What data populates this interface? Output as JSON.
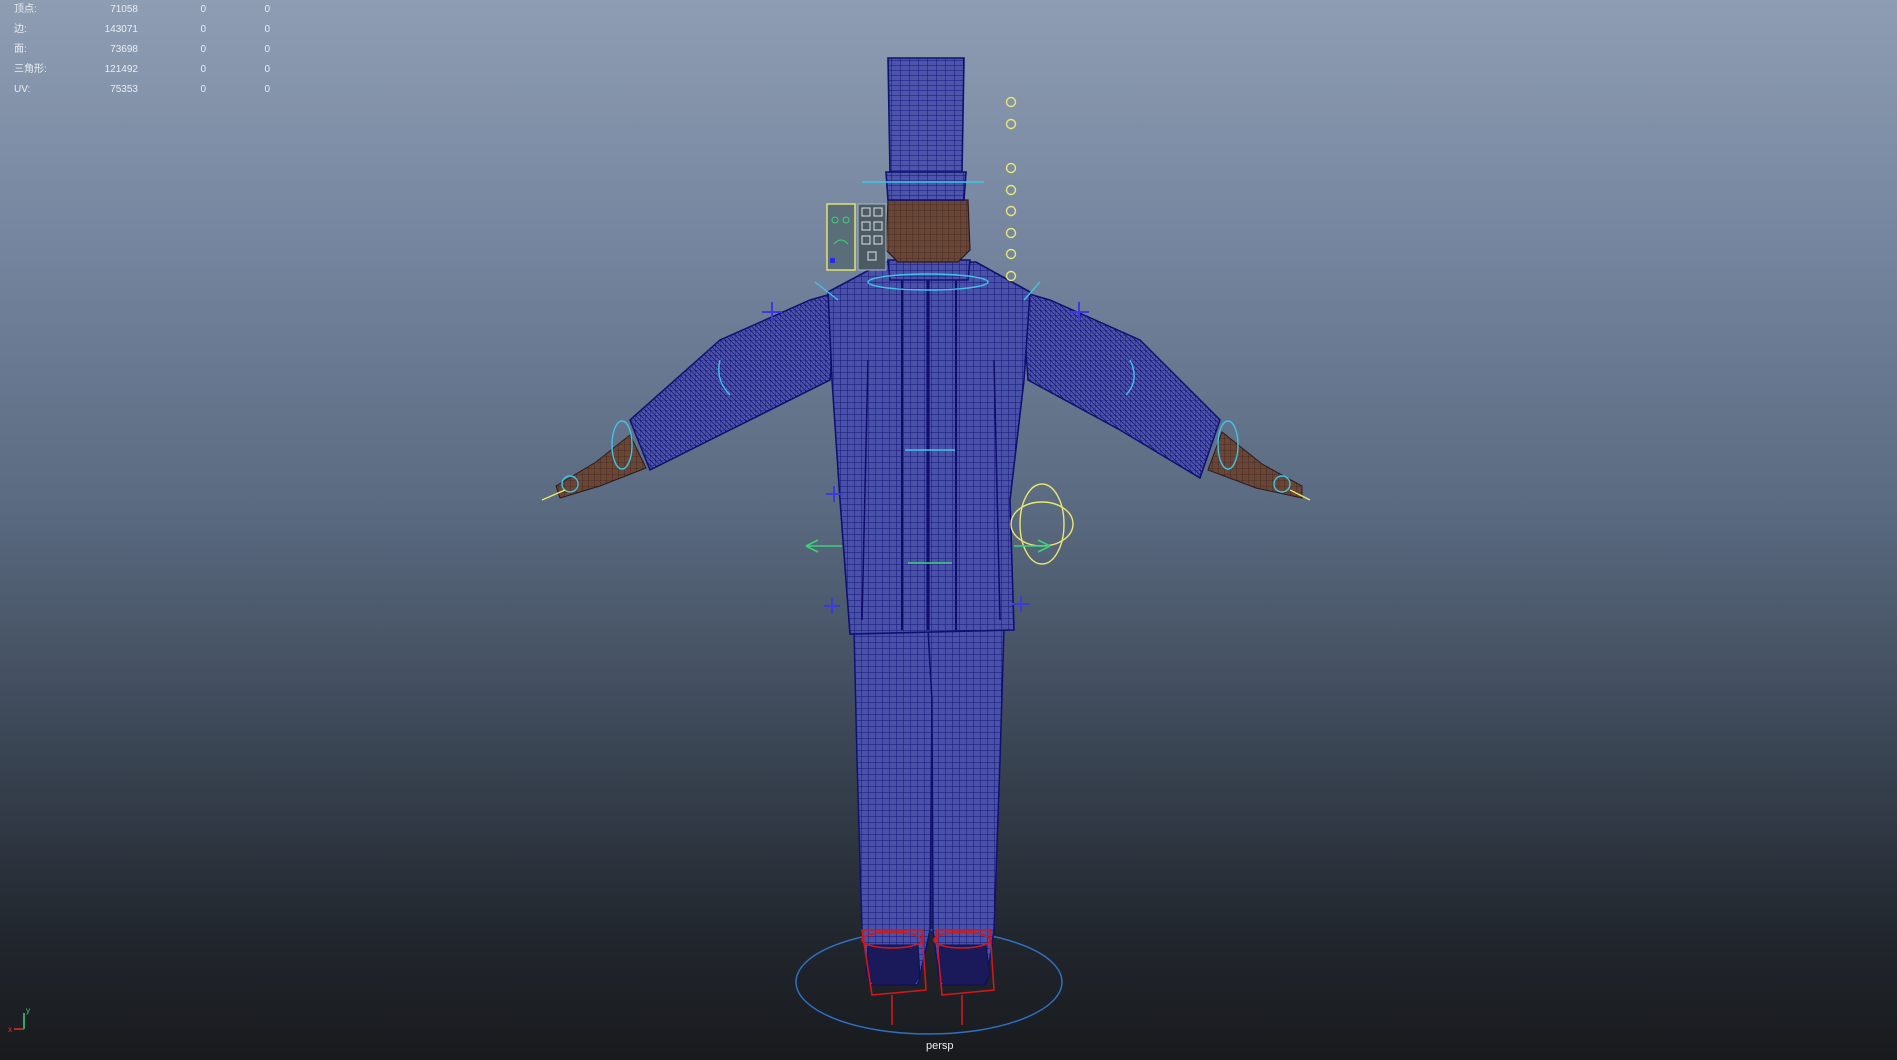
{
  "hud": {
    "rows": [
      {
        "label": "顶点:",
        "total": "71058",
        "selected": "0",
        "component": "0"
      },
      {
        "label": "边:",
        "total": "143071",
        "selected": "0",
        "component": "0"
      },
      {
        "label": "面:",
        "total": "73698",
        "selected": "0",
        "component": "0"
      },
      {
        "label": "三角形:",
        "total": "121492",
        "selected": "0",
        "component": "0"
      },
      {
        "label": "UV:",
        "total": "75353",
        "selected": "0",
        "component": "0"
      }
    ]
  },
  "viewport": {
    "camera_label": "persp",
    "axis_y_label": "y",
    "axis_x_label": "x"
  },
  "colors": {
    "wireframe": "#1a1a8a",
    "rig_control_cyan": "#3fc4e8",
    "rig_control_yellow": "#e8e870",
    "rig_control_green": "#3fd07a",
    "rig_control_blue": "#3a3adf",
    "foot_control_red": "#d01818",
    "skin": "#5b3a2a"
  },
  "icons": [
    "pivot-cross-icon",
    "view-axis-icon",
    "facial-control-panel-icon"
  ]
}
